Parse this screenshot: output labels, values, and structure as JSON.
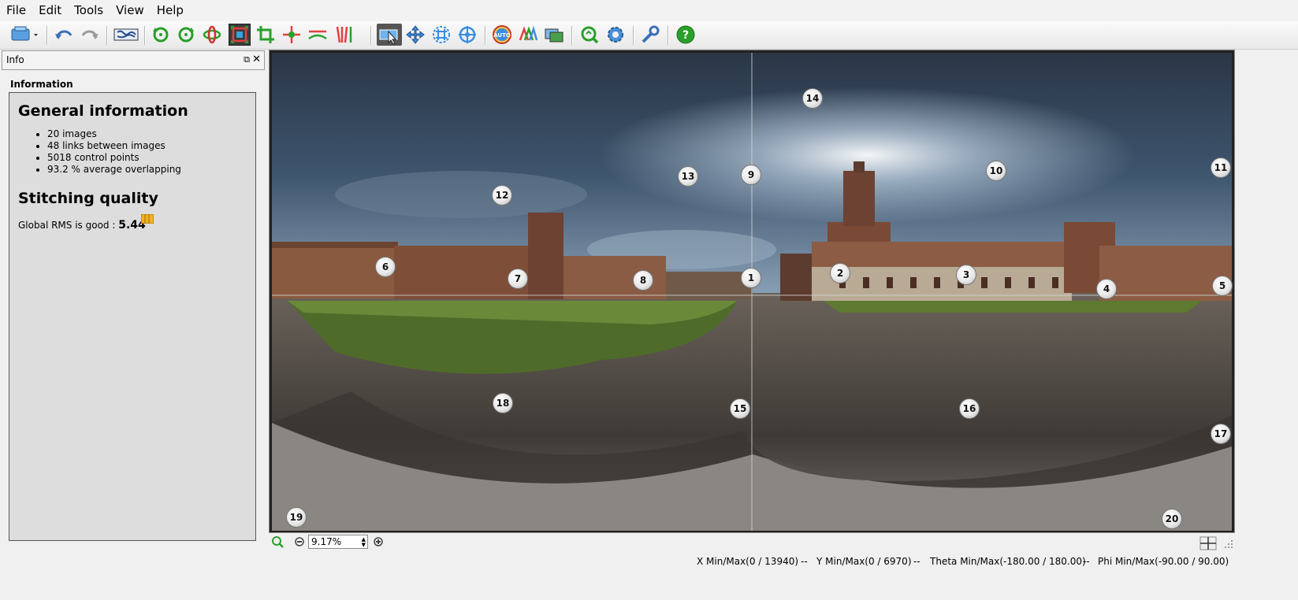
{
  "menu": [
    "File",
    "Edit",
    "Tools",
    "View",
    "Help"
  ],
  "toolbar_icons": [
    "export-dropdown-icon",
    "undo-icon",
    "redo-icon",
    "world-map-icon",
    "rotate-ccw-icon",
    "rotate-cw-icon",
    "rotate-3d-icon",
    "crop-fit-icon",
    "crop-icon",
    "identify-icon",
    "horizon-icon",
    "vertical-lines-icon",
    "select-tool-icon",
    "drag-tool-icon",
    "grid-tool-icon",
    "center-tool-icon",
    "auto-stitch-icon",
    "color-balance-icon",
    "preview-images-icon",
    "refresh-icon",
    "settings-icon",
    "tools-wrench-icon",
    "help-icon"
  ],
  "dock": {
    "title": "Info",
    "float_glyph": "⧉",
    "close_glyph": "✕"
  },
  "info": {
    "heading": "Information",
    "general_title": "General information",
    "general_items": [
      "20 images",
      "48 links between images",
      "5018 control points",
      "93.2 % average overlapping"
    ],
    "quality_title": "Stitching quality",
    "rms_text": "Global RMS is good : ",
    "rms_value": "5.44"
  },
  "control_points": [
    "1",
    "2",
    "3",
    "4",
    "5",
    "6",
    "7",
    "8",
    "9",
    "10",
    "11",
    "12",
    "13",
    "14",
    "15",
    "16",
    "17",
    "18",
    "19",
    "20"
  ],
  "zoom": {
    "value": "9.17%"
  },
  "status": {
    "x": "X Min/Max(0 / 13940)",
    "sep1": "--",
    "y": "Y Min/Max(0 / 6970)",
    "sep2": "--",
    "theta": "Theta Min/Max(-180.00 / 180.00)",
    "sep3": "--",
    "phi": "Phi Min/Max(-90.00 / 90.00)"
  },
  "colors": {
    "sky_top": "#2d3a4a",
    "sky_bright": "#c9d6e3",
    "brick": "#7a4a36",
    "grass": "#4f6b2a",
    "pavement": "#5a5450",
    "accent_blue": "#1e7bd1",
    "accent_green": "#2aa02a"
  }
}
